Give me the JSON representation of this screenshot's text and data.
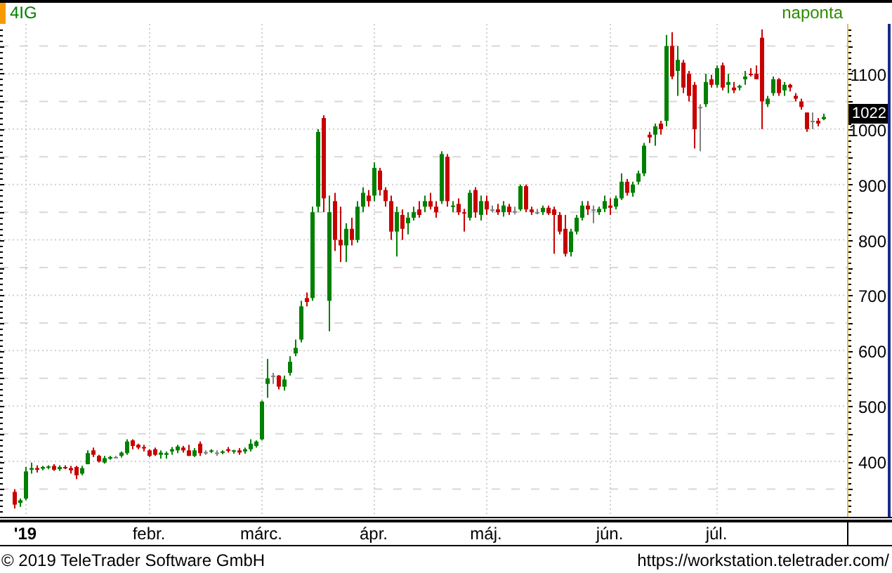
{
  "chart": {
    "title": "4IG",
    "interval": "naponta",
    "last_value": "1022",
    "chart_data": {
      "type": "candlestick",
      "grid": true,
      "ylim": [
        300,
        1190
      ],
      "yticks": [
        400,
        500,
        600,
        700,
        800,
        900,
        1000,
        1100
      ],
      "categories": [
        null,
        null,
        "'19",
        null,
        null,
        null,
        null,
        null,
        null,
        null,
        null,
        null,
        null,
        null,
        null,
        null,
        null,
        null,
        null,
        null,
        null,
        null,
        null,
        null,
        "febr.",
        null,
        null,
        null,
        null,
        null,
        null,
        null,
        null,
        null,
        null,
        null,
        null,
        null,
        null,
        null,
        null,
        null,
        null,
        null,
        "márc.",
        null,
        null,
        null,
        null,
        null,
        null,
        null,
        null,
        null,
        null,
        null,
        null,
        null,
        null,
        null,
        null,
        null,
        null,
        null,
        "ápr.",
        null,
        null,
        null,
        null,
        null,
        null,
        null,
        null,
        null,
        null,
        null,
        null,
        null,
        null,
        null,
        null,
        null,
        null,
        null,
        "máj.",
        null,
        null,
        null,
        null,
        null,
        null,
        null,
        null,
        null,
        null,
        null,
        null,
        null,
        null,
        null,
        null,
        null,
        null,
        null,
        null,
        null,
        "jún.",
        null,
        null,
        null,
        null,
        null,
        null,
        null,
        null,
        null,
        null,
        null,
        null,
        null,
        null,
        null,
        null,
        null,
        null,
        "júl.",
        null,
        null,
        null,
        null,
        null,
        null,
        null,
        null,
        null,
        null,
        null,
        null,
        null,
        null,
        null,
        null,
        null,
        null,
        null
      ],
      "ohlc": [
        [
          345,
          350,
          315,
          322
        ],
        [
          325,
          333,
          318,
          330
        ],
        [
          333,
          390,
          330,
          382
        ],
        [
          385,
          398,
          378,
          388
        ],
        [
          388,
          393,
          380,
          385
        ],
        [
          387,
          392,
          384,
          390
        ],
        [
          390,
          393,
          386,
          391
        ],
        [
          392,
          395,
          383,
          385
        ],
        [
          386,
          393,
          383,
          390
        ],
        [
          390,
          393,
          386,
          388
        ],
        [
          388,
          392,
          378,
          384
        ],
        [
          390,
          392,
          368,
          375
        ],
        [
          378,
          392,
          375,
          388
        ],
        [
          395,
          420,
          395,
          415
        ],
        [
          420,
          425,
          408,
          412
        ],
        [
          410,
          412,
          398,
          400
        ],
        [
          398,
          410,
          396,
          406
        ],
        [
          405,
          410,
          403,
          408
        ],
        [
          408,
          410,
          406,
          408
        ],
        [
          410,
          418,
          407,
          416
        ],
        [
          415,
          440,
          412,
          436
        ],
        [
          438,
          440,
          422,
          428
        ],
        [
          430,
          432,
          422,
          425
        ],
        [
          426,
          430,
          418,
          424
        ],
        [
          420,
          422,
          408,
          410
        ],
        [
          422,
          425,
          410,
          412
        ],
        [
          412,
          420,
          405,
          416
        ],
        [
          412,
          418,
          405,
          415
        ],
        [
          418,
          426,
          412,
          422
        ],
        [
          420,
          430,
          415,
          427
        ],
        [
          425,
          428,
          416,
          420
        ],
        [
          420,
          430,
          410,
          410
        ],
        [
          410,
          424,
          408,
          420
        ],
        [
          432,
          436,
          410,
          415
        ],
        [
          417,
          420,
          412,
          417
        ],
        [
          418,
          422,
          415,
          420
        ],
        [
          416,
          420,
          410,
          416
        ],
        [
          416,
          420,
          413,
          418
        ],
        [
          422,
          426,
          416,
          419
        ],
        [
          418,
          421,
          414,
          420
        ],
        [
          420,
          424,
          412,
          416
        ],
        [
          418,
          425,
          414,
          422
        ],
        [
          422,
          440,
          418,
          432
        ],
        [
          428,
          438,
          425,
          436
        ],
        [
          440,
          510,
          438,
          508
        ],
        [
          540,
          585,
          515,
          550
        ],
        [
          555,
          560,
          540,
          555
        ],
        [
          555,
          556,
          530,
          535
        ],
        [
          535,
          555,
          528,
          548
        ],
        [
          560,
          590,
          555,
          580
        ],
        [
          595,
          620,
          590,
          605
        ],
        [
          620,
          690,
          615,
          680
        ],
        [
          695,
          705,
          680,
          688
        ],
        [
          695,
          860,
          690,
          850
        ],
        [
          860,
          1000,
          850,
          995
        ],
        [
          1020,
          1025,
          850,
          875
        ],
        [
          690,
          880,
          635,
          850
        ],
        [
          870,
          885,
          780,
          800
        ],
        [
          800,
          860,
          760,
          790
        ],
        [
          790,
          830,
          760,
          820
        ],
        [
          820,
          840,
          790,
          800
        ],
        [
          800,
          870,
          795,
          860
        ],
        [
          860,
          895,
          850,
          885
        ],
        [
          880,
          890,
          860,
          870
        ],
        [
          880,
          940,
          870,
          930
        ],
        [
          925,
          930,
          880,
          890
        ],
        [
          890,
          895,
          860,
          870
        ],
        [
          870,
          880,
          800,
          815
        ],
        [
          815,
          860,
          770,
          850
        ],
        [
          845,
          855,
          800,
          820
        ],
        [
          830,
          850,
          810,
          840
        ],
        [
          840,
          860,
          835,
          850
        ],
        [
          855,
          870,
          840,
          845
        ],
        [
          860,
          880,
          850,
          870
        ],
        [
          870,
          885,
          855,
          860
        ],
        [
          860,
          870,
          840,
          850
        ],
        [
          870,
          960,
          865,
          955
        ],
        [
          950,
          955,
          860,
          870
        ],
        [
          860,
          870,
          850,
          862
        ],
        [
          865,
          875,
          845,
          850
        ],
        [
          850,
          856,
          815,
          848
        ],
        [
          840,
          890,
          835,
          885
        ],
        [
          890,
          895,
          840,
          850
        ],
        [
          845,
          880,
          835,
          870
        ],
        [
          870,
          880,
          845,
          855
        ],
        [
          855,
          862,
          850,
          855
        ],
        [
          855,
          865,
          845,
          850
        ],
        [
          850,
          870,
          842,
          862
        ],
        [
          860,
          865,
          845,
          850
        ],
        [
          852,
          860,
          846,
          852
        ],
        [
          855,
          900,
          852,
          897
        ],
        [
          897,
          900,
          850,
          855
        ],
        [
          855,
          860,
          845,
          850
        ],
        [
          850,
          856,
          846,
          850
        ],
        [
          850,
          862,
          845,
          858
        ],
        [
          858,
          862,
          845,
          848
        ],
        [
          855,
          860,
          775,
          845
        ],
        [
          845,
          850,
          810,
          815
        ],
        [
          820,
          845,
          770,
          775
        ],
        [
          778,
          820,
          770,
          815
        ],
        [
          815,
          845,
          810,
          840
        ],
        [
          840,
          870,
          835,
          862
        ],
        [
          862,
          870,
          845,
          855
        ],
        [
          855,
          862,
          830,
          855
        ],
        [
          850,
          860,
          845,
          856
        ],
        [
          856,
          880,
          850,
          870
        ],
        [
          862,
          875,
          845,
          858
        ],
        [
          860,
          880,
          855,
          875
        ],
        [
          875,
          920,
          872,
          905
        ],
        [
          905,
          910,
          880,
          885
        ],
        [
          885,
          905,
          878,
          900
        ],
        [
          905,
          925,
          900,
          920
        ],
        [
          920,
          975,
          915,
          970
        ],
        [
          990,
          995,
          975,
          985
        ],
        [
          990,
          1010,
          970,
          1005
        ],
        [
          1010,
          1015,
          990,
          1000
        ],
        [
          1015,
          1170,
          1005,
          1150
        ],
        [
          1150,
          1175,
          1090,
          1095
        ],
        [
          1105,
          1150,
          1060,
          1125
        ],
        [
          1120,
          1125,
          1065,
          1075
        ],
        [
          1100,
          1105,
          1050,
          1060
        ],
        [
          1080,
          1085,
          965,
          1000
        ],
        [
          1040,
          1045,
          960,
          1040
        ],
        [
          1045,
          1100,
          1040,
          1085
        ],
        [
          1090,
          1098,
          1075,
          1080
        ],
        [
          1080,
          1115,
          1075,
          1110
        ],
        [
          1115,
          1120,
          1070,
          1075
        ],
        [
          1080,
          1100,
          1065,
          1085
        ],
        [
          1075,
          1085,
          1065,
          1070
        ],
        [
          1075,
          1080,
          1070,
          1078
        ],
        [
          1090,
          1105,
          1080,
          1095
        ],
        [
          1100,
          1110,
          1095,
          1098
        ],
        [
          1100,
          1115,
          1090,
          1090
        ],
        [
          1165,
          1180,
          1000,
          1050
        ],
        [
          1045,
          1060,
          1040,
          1055
        ],
        [
          1065,
          1095,
          1060,
          1090
        ],
        [
          1090,
          1092,
          1060,
          1065
        ],
        [
          1070,
          1085,
          1060,
          1080
        ],
        [
          1080,
          1082,
          1068,
          1075
        ],
        [
          1060,
          1065,
          1050,
          1055
        ],
        [
          1050,
          1055,
          1035,
          1040
        ],
        [
          1030,
          1030,
          995,
          1000
        ],
        [
          1015,
          1030,
          1000,
          1015
        ],
        [
          1015,
          1020,
          1005,
          1010
        ],
        [
          1018,
          1028,
          1016,
          1022
        ]
      ]
    }
  },
  "footer": {
    "copyright": "© 2019 TeleTrader Software GmbH",
    "url": "https://workstation.teletrader.com/"
  }
}
